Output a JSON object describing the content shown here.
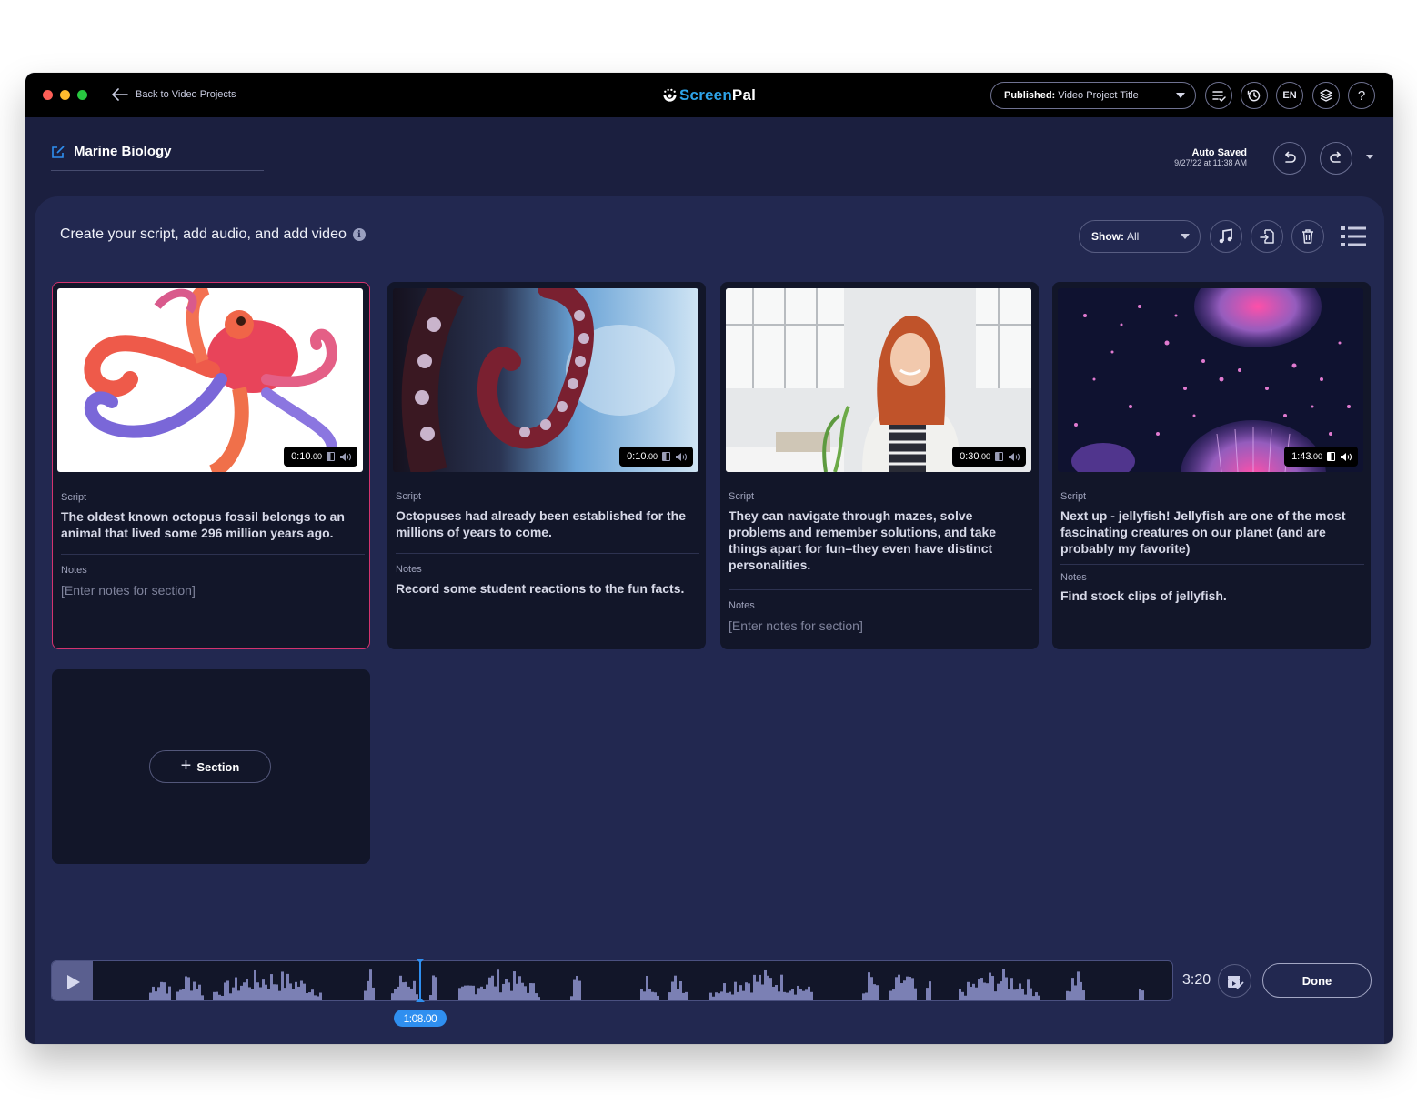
{
  "titlebar": {
    "back_label": "Back to Video Projects",
    "logo_screen": "Screen",
    "logo_pal": "Pal",
    "publish_prefix": "Published:",
    "publish_value": "Video Project Title",
    "language": "EN",
    "help": "?"
  },
  "project": {
    "name": "Marine Biology",
    "autosave_label": "Auto Saved",
    "autosave_time": "9/27/22 at 11:38 AM"
  },
  "panel": {
    "title": "Create your script, add audio, and add video",
    "info": "i",
    "show_prefix": "Show:",
    "show_value": "All"
  },
  "sections": [
    {
      "duration": "0:10",
      "duration_frac": ".00",
      "script_label": "Script",
      "script": "The oldest known octopus fossil belongs to an animal that lived some 296 million years ago.",
      "notes_label": "Notes",
      "notes": "[Enter notes for section]",
      "notes_placeholder": true,
      "selected": true,
      "thumbnail": "watercolor-octopus"
    },
    {
      "duration": "0:10",
      "duration_frac": ".00",
      "script_label": "Script",
      "script": "Octopuses had already been established for the millions of years to come.",
      "notes_label": "Notes",
      "notes": "Record some student reactions to the fun facts.",
      "notes_placeholder": false,
      "selected": false,
      "thumbnail": "octopus-tentacle"
    },
    {
      "duration": "0:30",
      "duration_frac": ".00",
      "script_label": "Script",
      "script": "They can navigate through mazes, solve problems and remember solutions, and take things apart for fun–they even have distinct personalities.",
      "notes_label": "Notes",
      "notes": "[Enter notes for section]",
      "notes_placeholder": true,
      "selected": false,
      "thumbnail": "woman-presenter"
    },
    {
      "duration": "1:43",
      "duration_frac": ".00",
      "script_label": "Script",
      "script": "Next up - jellyfish! Jellyfish are one of the most fascinating creatures on our planet (and are probably my favorite)",
      "notes_label": "Notes",
      "notes": "Find stock clips of jellyfish.",
      "notes_placeholder": false,
      "selected": false,
      "thumbnail": "jellyfish"
    }
  ],
  "add_section_label": "Section",
  "timeline": {
    "playhead_time": "1:08.00",
    "total_time": "3:20",
    "done_label": "Done",
    "playhead_fraction": 0.34
  },
  "colors": {
    "accent_blue": "#2f8ff0",
    "selected_border": "#d4336e",
    "logo_blue": "#2ea3e8",
    "background": "#1b1f3f",
    "panel": "#222850",
    "card": "#121629"
  }
}
